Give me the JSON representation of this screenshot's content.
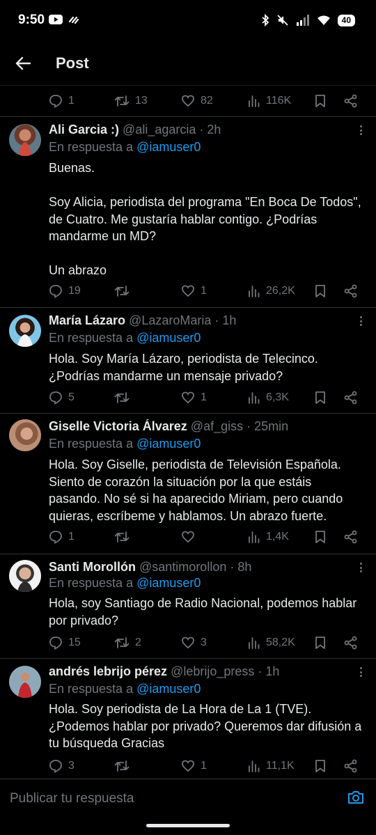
{
  "status_bar": {
    "time": "9:50",
    "battery": "40"
  },
  "header": {
    "title": "Post"
  },
  "top_stats": {
    "replies": "1",
    "reposts": "13",
    "likes": "82",
    "views": "116K"
  },
  "replies": [
    {
      "name": "Ali Garcia :)",
      "handle": "@ali_agarcia",
      "time": "· 2h",
      "reply_prefix": "En respuesta a",
      "mention": "@iamuser0",
      "text": "Buenas.\n\nSoy Alicia, periodista del programa \"En Boca De Todos\", de Cuatro. Me gustaría hablar contigo. ¿Podrías mandarme un MD?\n\nUn abrazo",
      "replies": "19",
      "reposts": "",
      "likes": "1",
      "views": "26,2K"
    },
    {
      "name": "María Lázaro",
      "handle": "@LazaroMaria",
      "time": "· 1h",
      "reply_prefix": "En respuesta a",
      "mention": "@iamuser0",
      "text": "Hola. Soy María Lázaro, periodista de Telecinco. ¿Podrías mandarme un mensaje privado?",
      "replies": "5",
      "reposts": "",
      "likes": "1",
      "views": "6,3K"
    },
    {
      "name": "Giselle Victoria Álvarez",
      "handle": "@af_giss",
      "time": "· 25min",
      "reply_prefix": "En respuesta a",
      "mention": "@iamuser0",
      "text": "Hola. Soy Giselle, periodista de Televisión Española. Siento de corazón la situación por la que estáis pasando. No sé si ha aparecido Miriam, pero cuando quieras, escríbeme y hablamos. Un abrazo fuerte.",
      "replies": "1",
      "reposts": "",
      "likes": "",
      "views": "1,4K"
    },
    {
      "name": "Santi Morollón",
      "handle": "@santimorollon",
      "time": "· 8h",
      "reply_prefix": "En respuesta a",
      "mention": "@iamuser0",
      "text": "Hola, soy Santiago de Radio Nacional, podemos hablar por privado?",
      "replies": "15",
      "reposts": "2",
      "likes": "3",
      "views": "58,2K"
    },
    {
      "name": "andrés lebrijo pérez",
      "handle": "@lebrijo_press",
      "time": "· 1h",
      "reply_prefix": "En respuesta a",
      "mention": "@iamuser0",
      "text": "Hola. Soy periodista de La Hora de La 1 (TVE). ¿Podemos hablar por privado? Queremos dar difusión a tu búsqueda Gracias",
      "replies": "3",
      "reposts": "",
      "likes": "1",
      "views": "11,1K"
    }
  ],
  "composer": {
    "placeholder": "Publicar tu respuesta"
  },
  "colors": {
    "background": "#000000",
    "text": "#e7e9ea",
    "muted": "#71767b",
    "accent": "#1d9bf0",
    "divider": "#2f3336"
  },
  "icons": [
    "back-arrow-icon",
    "reply-icon",
    "repost-icon",
    "like-icon",
    "views-icon",
    "bookmark-icon",
    "share-icon",
    "more-icon",
    "camera-icon"
  ]
}
